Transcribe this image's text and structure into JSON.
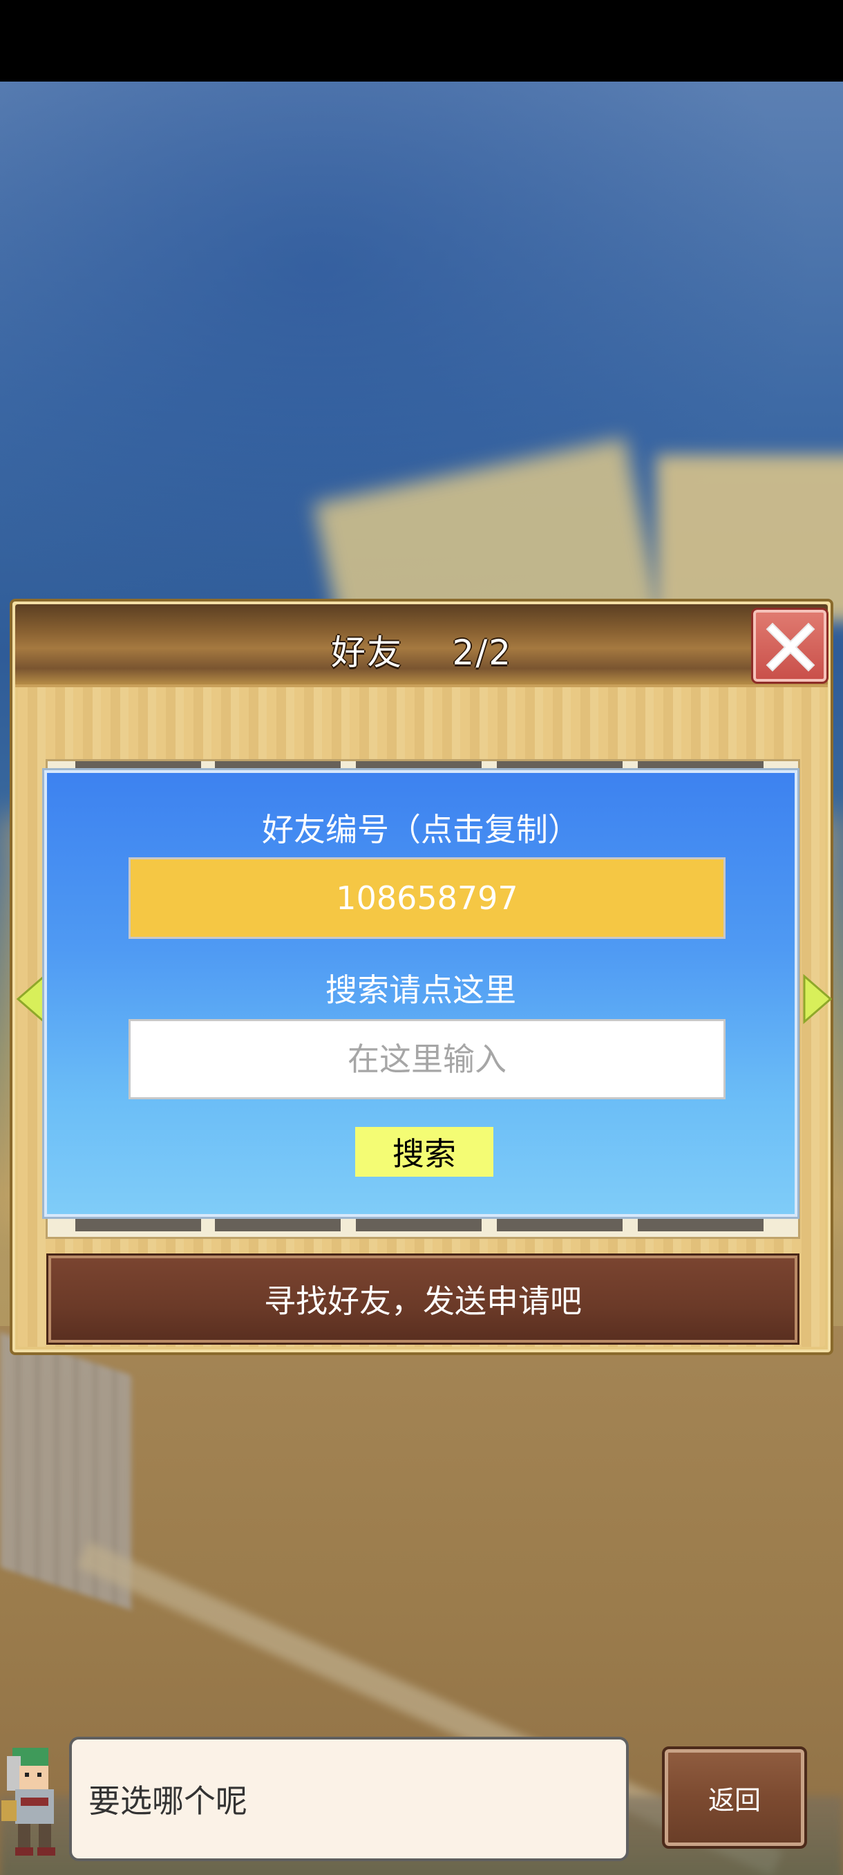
{
  "panel": {
    "title": "好友    2/2",
    "close_icon": "close-x-icon"
  },
  "dialog": {
    "friend_id_label": "好友编号（点击复制）",
    "friend_id_value": "108658797",
    "search_hint": "搜索请点这里",
    "search_placeholder": "在这里输入",
    "search_button": "搜索"
  },
  "footer_bar": {
    "text": "寻找好友，发送申请吧"
  },
  "speech": {
    "text": "要选哪个呢"
  },
  "back_button": {
    "label": "返回"
  },
  "colors": {
    "friend_id_box": "#f5c744",
    "search_button": "#f4fc74",
    "dialog_top": "#3d82f0",
    "dialog_bottom": "#7fccf8",
    "close_button": "#d0605a",
    "brown_bar": "#6b3a28"
  }
}
